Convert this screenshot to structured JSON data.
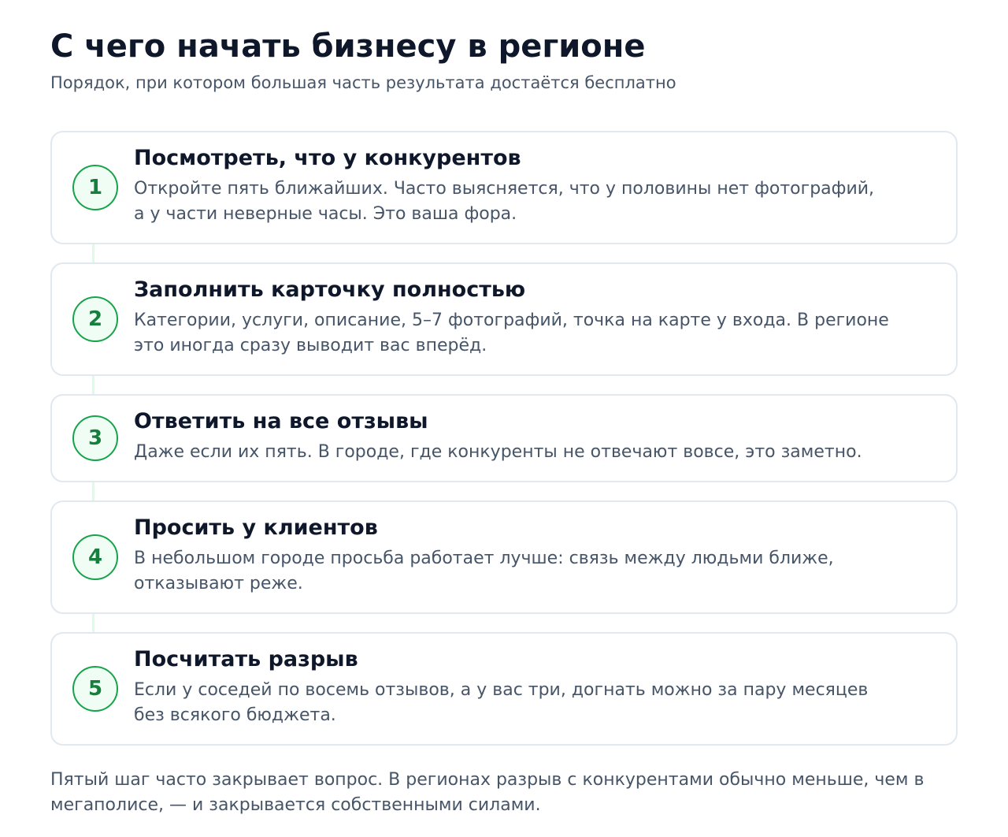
{
  "header": {
    "title": "С чего начать бизнесу в регионе",
    "subtitle": "Порядок, при котором большая часть результата достаётся бесплатно"
  },
  "steps": [
    {
      "number": "1",
      "title": "Посмотреть, что у конкурентов",
      "text": "Откройте пять ближайших. Часто выясняется, что у половины нет фотографий, а у части неверные часы. Это ваша фора."
    },
    {
      "number": "2",
      "title": "Заполнить карточку полностью",
      "text": "Категории, услуги, описание, 5–7 фотографий, точка на карте у входа. В регионе это иногда сразу выводит вас вперёд."
    },
    {
      "number": "3",
      "title": "Ответить на все отзывы",
      "text": "Даже если их пять. В городе, где конкуренты не отвечают вовсе, это заметно."
    },
    {
      "number": "4",
      "title": "Просить у клиентов",
      "text": "В небольшом городе просьба работает лучше: связь между людьми ближе, отказывают реже."
    },
    {
      "number": "5",
      "title": "Посчитать разрыв",
      "text": "Если у соседей по восемь отзывов, а у вас три, догнать можно за пару месяцев без всякого бюджета."
    }
  ],
  "footer": {
    "text": "Пятый шаг часто закрывает вопрос. В регионах разрыв с конкурентами обычно меньше, чем в мегаполисе, — и закрывается собственными силами."
  },
  "colors": {
    "accent": "#16a34a",
    "accent_text": "#15803d",
    "accent_bg": "#f0fdf4",
    "connector": "#dcfce7",
    "card_border": "#e2e8f0",
    "heading": "#0f172a",
    "body_text": "#475569"
  }
}
